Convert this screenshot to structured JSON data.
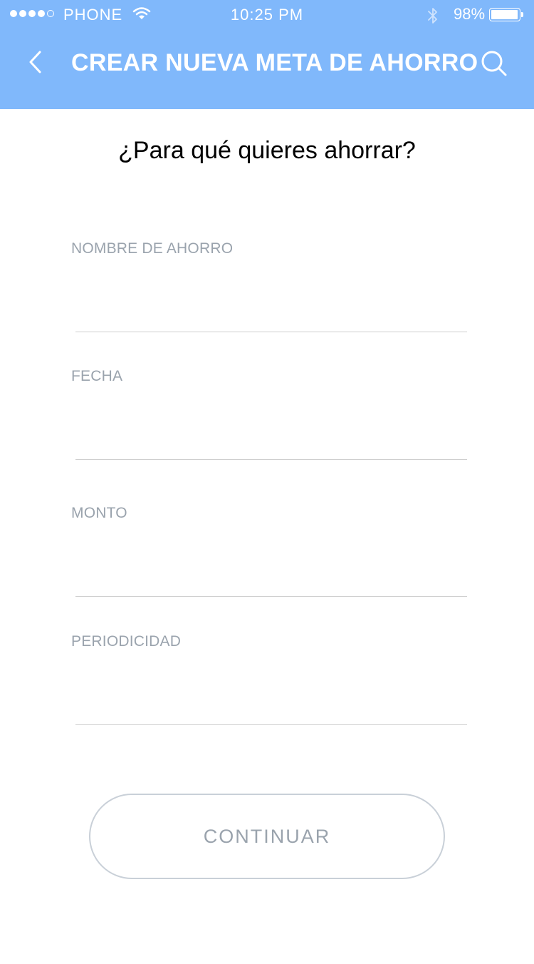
{
  "status_bar": {
    "carrier": "PHONE",
    "time": "10:25 PM",
    "battery_percent": "98%",
    "battery_level": 0.98,
    "signal_bars_filled": 4,
    "signal_bars_total": 5
  },
  "nav": {
    "title": "CREAR NUEVA META DE AHORRO",
    "back_icon": "chevron-left-icon",
    "search_icon": "search-icon"
  },
  "form": {
    "question": "¿Para qué quieres ahorrar?",
    "fields": [
      {
        "label": "NOMBRE DE AHORRO",
        "value": ""
      },
      {
        "label": "FECHA",
        "value": ""
      },
      {
        "label": "MONTO",
        "value": ""
      },
      {
        "label": "PERIODICIDAD",
        "value": ""
      }
    ],
    "continue_label": "CONTINUAR"
  },
  "colors": {
    "header_background": "#80b8fb",
    "label_text": "#9aa3ad",
    "button_border": "#c9d0d8",
    "divider": "#cfcfcf"
  }
}
